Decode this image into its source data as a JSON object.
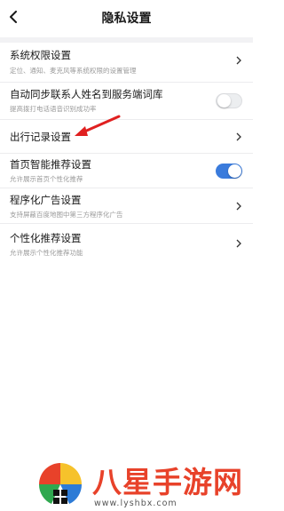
{
  "header": {
    "title": "隐私设置",
    "back_icon": "back-chevron-icon"
  },
  "settings": [
    {
      "title": "系统权限设置",
      "subtitle": "定位、通知、麦克风等系统权限的设置管理",
      "control": "chevron"
    },
    {
      "title": "自动同步联系人姓名到服务端词库",
      "subtitle": "提高拨打电话语音识别成功率",
      "control": "toggle",
      "enabled": false
    },
    {
      "title": "出行记录设置",
      "subtitle": "",
      "control": "chevron"
    },
    {
      "title": "首页智能推荐设置",
      "subtitle": "允许展示首页个性化推荐",
      "control": "toggle",
      "enabled": true
    },
    {
      "title": "程序化广告设置",
      "subtitle": "支持屏蔽百度地图中第三方程序化广告",
      "control": "chevron"
    },
    {
      "title": "个性化推荐设置",
      "subtitle": "允许展示个性化推荐功能",
      "control": "chevron"
    }
  ],
  "watermark": {
    "text": "八星手游网",
    "url": "www.lyshbx.com"
  },
  "colors": {
    "toggle_on": "#3a7bdc",
    "annotation_arrow": "#e02020",
    "watermark": "#e8422a"
  }
}
